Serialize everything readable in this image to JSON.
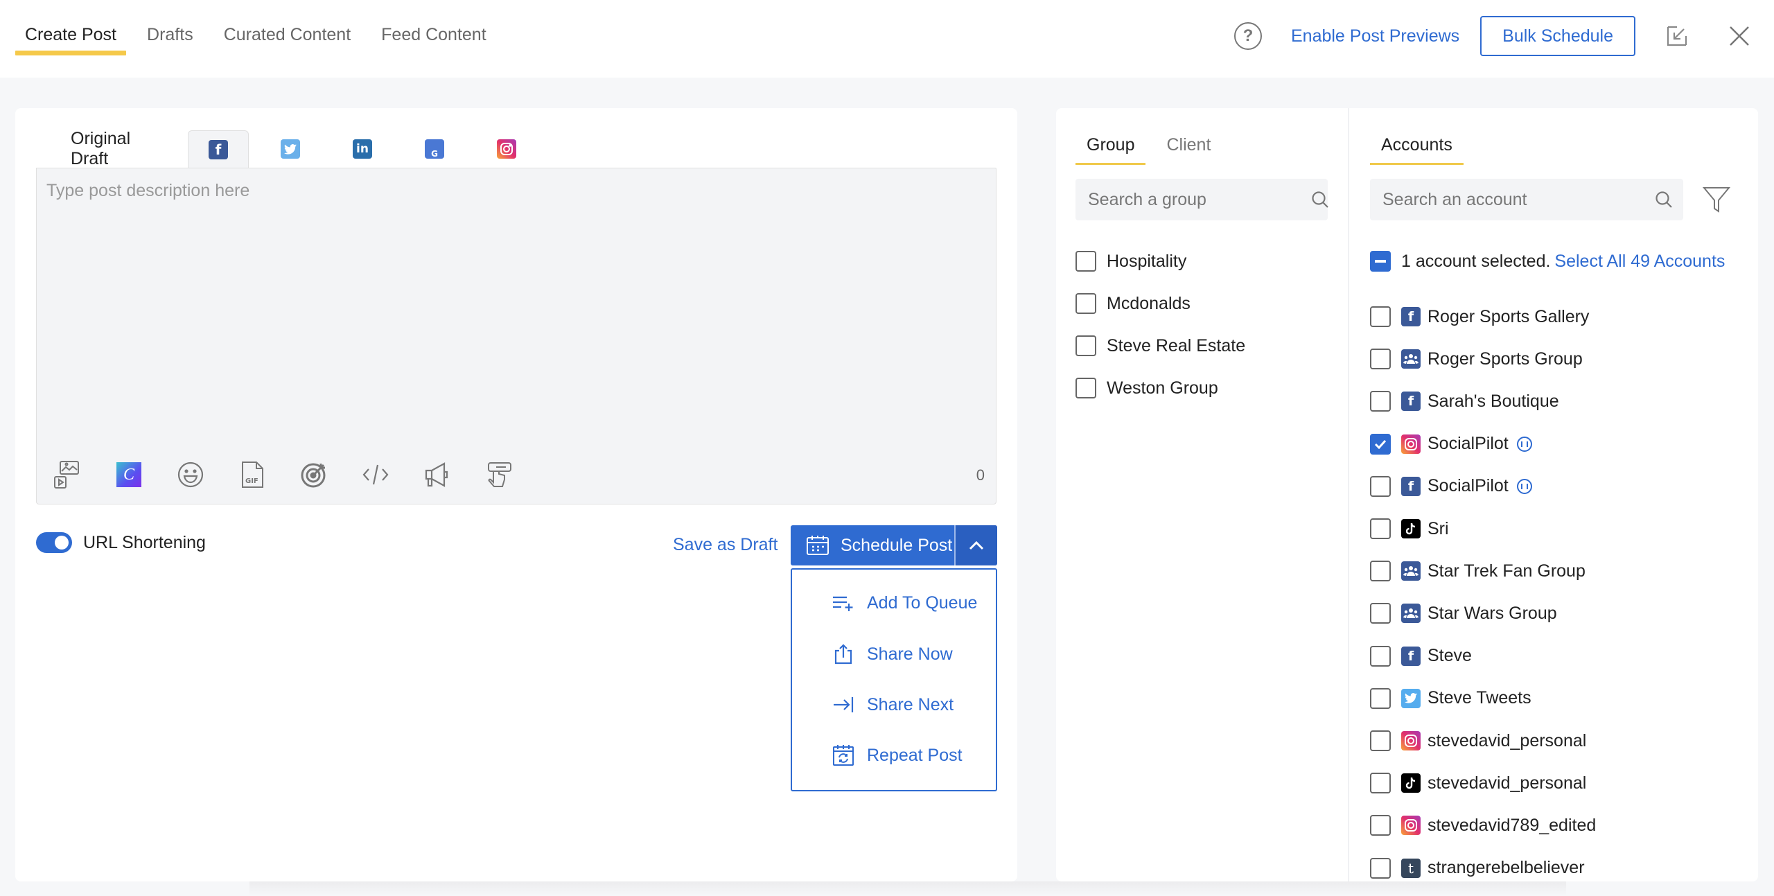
{
  "header": {
    "tabs": [
      {
        "label": "Create Post",
        "active": true
      },
      {
        "label": "Drafts",
        "active": false
      },
      {
        "label": "Curated Content",
        "active": false
      },
      {
        "label": "Feed Content",
        "active": false
      }
    ],
    "help_icon": "question-circle-icon",
    "enable_previews_label": "Enable Post Previews",
    "bulk_schedule_label": "Bulk Schedule",
    "minimize_icon": "minimize-arrow-icon",
    "close_icon": "close-icon"
  },
  "editor": {
    "original_draft_label": "Original Draft",
    "network_tabs": [
      {
        "network": "facebook",
        "icon": "facebook-icon",
        "active": true
      },
      {
        "network": "twitter",
        "icon": "twitter-icon",
        "active": false
      },
      {
        "network": "linkedin",
        "icon": "linkedin-icon",
        "active": false
      },
      {
        "network": "google-business",
        "icon": "google-business-icon",
        "active": false
      },
      {
        "network": "instagram",
        "icon": "instagram-icon",
        "active": false
      }
    ],
    "placeholder": "Type post description here",
    "value": "",
    "char_count": "0",
    "tools": [
      "media-upload-icon",
      "canva-icon",
      "emoji-icon",
      "gif-icon",
      "target-icon",
      "code-icon",
      "megaphone-icon",
      "hand-pointer-icon"
    ],
    "url_shortening_label": "URL Shortening",
    "url_shortening_on": true,
    "save_draft_label": "Save as Draft",
    "schedule_label": "Schedule Post",
    "schedule_menu": [
      {
        "label": "Add To Queue",
        "icon": "queue-add-icon"
      },
      {
        "label": "Share Now",
        "icon": "share-icon"
      },
      {
        "label": "Share Next",
        "icon": "arrow-to-line-icon"
      },
      {
        "label": "Repeat Post",
        "icon": "calendar-repeat-icon"
      }
    ]
  },
  "groups": {
    "tabs": [
      {
        "label": "Group",
        "active": true
      },
      {
        "label": "Client",
        "active": false
      }
    ],
    "search_placeholder": "Search a group",
    "items": [
      {
        "label": "Hospitality",
        "checked": false
      },
      {
        "label": "Mcdonalds",
        "checked": false
      },
      {
        "label": "Steve Real Estate",
        "checked": false
      },
      {
        "label": "Weston Group",
        "checked": false
      }
    ]
  },
  "accounts": {
    "tab_label": "Accounts",
    "search_placeholder": "Search an account",
    "selected_text": "1 account selected.",
    "select_all_label": "Select All 49 Accounts",
    "items": [
      {
        "label": "Roger Sports Gallery",
        "network": "facebook",
        "checked": false,
        "paused": false
      },
      {
        "label": "Roger Sports Group",
        "network": "facebook-group",
        "checked": false,
        "paused": false
      },
      {
        "label": "Sarah's Boutique",
        "network": "facebook",
        "checked": false,
        "paused": false
      },
      {
        "label": "SocialPilot",
        "network": "instagram",
        "checked": true,
        "paused": true
      },
      {
        "label": "SocialPilot",
        "network": "facebook",
        "checked": false,
        "paused": true
      },
      {
        "label": "Sri",
        "network": "tiktok",
        "checked": false,
        "paused": false
      },
      {
        "label": "Star Trek Fan Group",
        "network": "facebook-group",
        "checked": false,
        "paused": false
      },
      {
        "label": "Star Wars Group",
        "network": "facebook-group",
        "checked": false,
        "paused": false
      },
      {
        "label": "Steve",
        "network": "facebook",
        "checked": false,
        "paused": false
      },
      {
        "label": "Steve Tweets",
        "network": "twitter",
        "checked": false,
        "paused": false
      },
      {
        "label": "stevedavid_personal",
        "network": "instagram",
        "checked": false,
        "paused": false
      },
      {
        "label": "stevedavid_personal",
        "network": "tiktok",
        "checked": false,
        "paused": false
      },
      {
        "label": "stevedavid789_edited",
        "network": "instagram",
        "checked": false,
        "paused": false
      },
      {
        "label": "strangerebelbeliever",
        "network": "tumblr",
        "checked": false,
        "paused": false
      }
    ]
  },
  "colors": {
    "accent": "#2f6bd1",
    "tab_underline": "#f5c94a",
    "facebook": "#3b5998",
    "twitter": "#55acee",
    "linkedin": "#0e76a8",
    "tiktok": "#000000",
    "tumblr": "#35465c"
  }
}
